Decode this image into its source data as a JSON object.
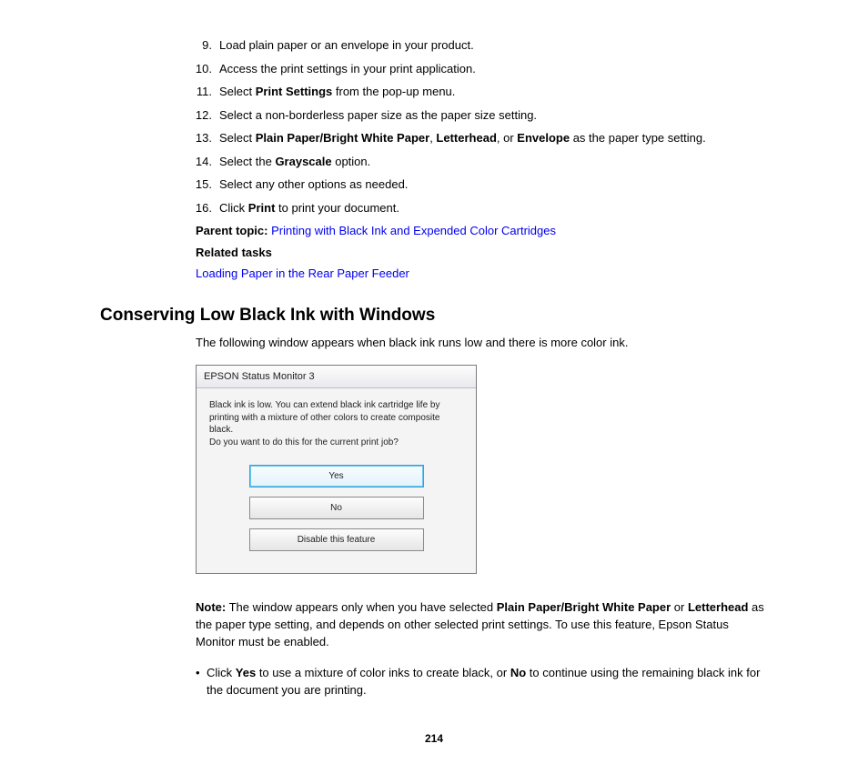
{
  "steps": [
    {
      "n": "9.",
      "segs": [
        {
          "t": "Load plain paper or an envelope in your product."
        }
      ]
    },
    {
      "n": "10.",
      "segs": [
        {
          "t": "Access the print settings in your print application."
        }
      ]
    },
    {
      "n": "11.",
      "segs": [
        {
          "t": "Select "
        },
        {
          "t": "Print Settings",
          "b": true
        },
        {
          "t": " from the pop-up menu."
        }
      ]
    },
    {
      "n": "12.",
      "segs": [
        {
          "t": "Select a non-borderless paper size as the paper size setting."
        }
      ]
    },
    {
      "n": "13.",
      "segs": [
        {
          "t": "Select "
        },
        {
          "t": "Plain Paper/Bright White Paper",
          "b": true
        },
        {
          "t": ", "
        },
        {
          "t": "Letterhead",
          "b": true
        },
        {
          "t": ", or "
        },
        {
          "t": "Envelope",
          "b": true
        },
        {
          "t": " as the paper type setting."
        }
      ]
    },
    {
      "n": "14.",
      "segs": [
        {
          "t": "Select the "
        },
        {
          "t": "Grayscale",
          "b": true
        },
        {
          "t": " option."
        }
      ]
    },
    {
      "n": "15.",
      "segs": [
        {
          "t": "Select any other options as needed."
        }
      ]
    },
    {
      "n": "16.",
      "segs": [
        {
          "t": "Click "
        },
        {
          "t": "Print",
          "b": true
        },
        {
          "t": " to print your document."
        }
      ]
    }
  ],
  "parent_topic_label": "Parent topic:",
  "parent_topic_link": "Printing with Black Ink and Expended Color Cartridges",
  "related_tasks_label": "Related tasks",
  "related_task_link": "Loading Paper in the Rear Paper Feeder",
  "heading": "Conserving Low Black Ink with Windows",
  "intro": "The following window appears when black ink runs low and there is more color ink.",
  "dialog": {
    "title": "EPSON Status Monitor 3",
    "message": "Black ink is low. You can extend black ink cartridge life by printing with a mixture of other colors to create composite black.\nDo you want to do this for the current print job?",
    "yes": "Yes",
    "no": "No",
    "disable": "Disable this feature"
  },
  "note": {
    "label": "Note:",
    "segs": [
      {
        "t": " The window appears only when you have selected "
      },
      {
        "t": "Plain Paper/Bright White Paper",
        "b": true
      },
      {
        "t": " or "
      },
      {
        "t": "Letterhead",
        "b": true
      },
      {
        "t": " as the paper type setting, and depends on other selected print settings. To use this feature, Epson Status Monitor must be enabled."
      }
    ]
  },
  "bullet": {
    "segs": [
      {
        "t": "Click "
      },
      {
        "t": "Yes",
        "b": true
      },
      {
        "t": " to use a mixture of color inks to create black, or "
      },
      {
        "t": "No",
        "b": true
      },
      {
        "t": " to continue using the remaining black ink for the document you are printing."
      }
    ]
  },
  "page_number": "214"
}
